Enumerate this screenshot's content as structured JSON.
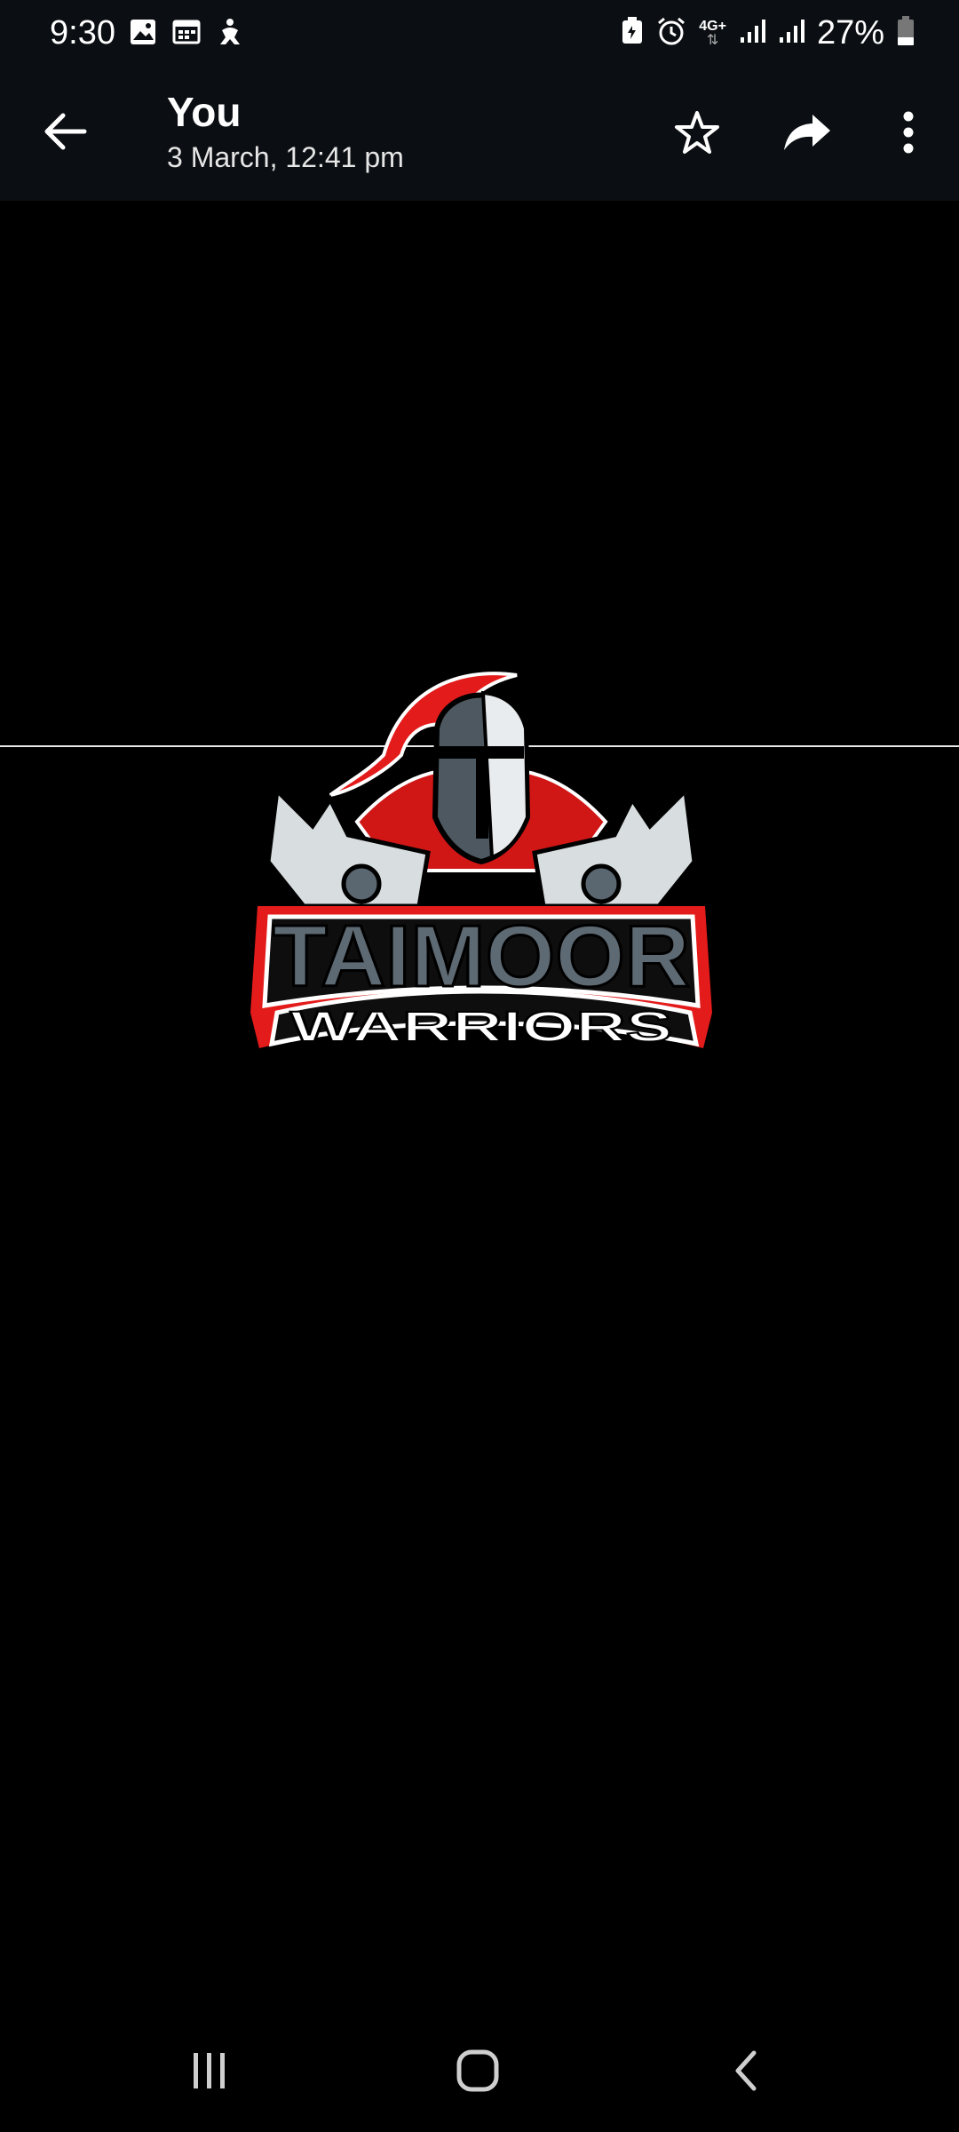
{
  "status_bar": {
    "time": "9:30",
    "network": "4G+",
    "battery": "27%",
    "left_icons": [
      "gallery-icon",
      "calendar-icon",
      "accessibility-icon"
    ],
    "right_icons": [
      "saver-icon",
      "alarm-icon",
      "data-arrows-icon",
      "signal-icon",
      "signal-icon",
      "battery-icon"
    ]
  },
  "app_bar": {
    "title": "You",
    "subtitle": "3 March, 12:41 pm",
    "actions": [
      "back-arrow-icon",
      "star-icon",
      "share-icon",
      "more-vert-icon"
    ]
  },
  "image": {
    "logo_line1": "TAIMOOR",
    "logo_line2": "WARRIORS",
    "colors": {
      "red": "#e31b1b",
      "steel": "#5a6670",
      "white": "#ffffff"
    }
  },
  "nav_bar": {
    "buttons": [
      "recent-apps-icon",
      "home-icon",
      "back-icon"
    ]
  }
}
